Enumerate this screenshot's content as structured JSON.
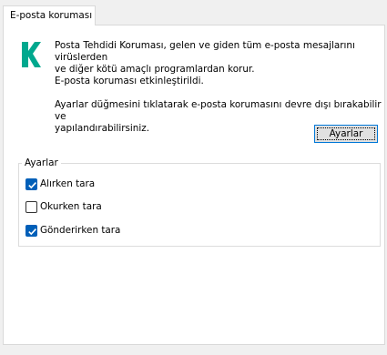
{
  "tab": {
    "label": "E-posta koruması"
  },
  "description": {
    "para1_line1": "Posta Tehdidi Koruması, gelen ve giden tüm e-posta mesajlarını virüslerden",
    "para1_line2": "ve diğer kötü amaçlı programlardan korur.",
    "status": "E-posta koruması etkinleştirildi.",
    "para2_line1": "Ayarlar düğmesini tıklatarak e-posta korumasını devre dışı bırakabilir ve",
    "para2_line2": "yapılandırabilirsiniz."
  },
  "settings_button": {
    "label": "Ayarlar"
  },
  "settings_group": {
    "title": "Ayarlar",
    "options": [
      {
        "label": "Alırken tara",
        "checked": true
      },
      {
        "label": "Okurken tara",
        "checked": false
      },
      {
        "label": "Gönderirken tara",
        "checked": true
      }
    ]
  },
  "colors": {
    "logo": "#00a88e",
    "checkbox": "#005fb8",
    "button_border": "#0078d7"
  },
  "icons": {
    "logo": "kaspersky-k-logo-icon",
    "check": "checkmark-icon"
  }
}
